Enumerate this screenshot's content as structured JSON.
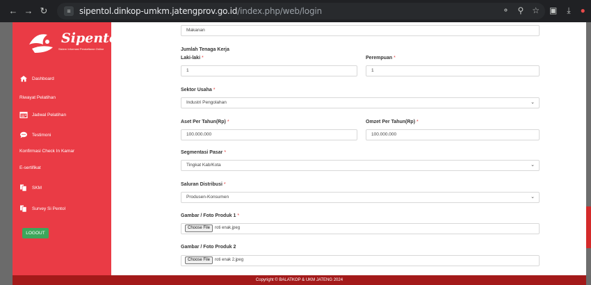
{
  "browser": {
    "url_host": "sipentol.dinkop-umkm.jatengprov.go.id",
    "url_path": "/index.php/web/login"
  },
  "sidebar": {
    "logo_text": "Sipentol",
    "logo_sub": "Sistem Informasi Pendaftaran Online",
    "items": [
      {
        "label": "Dashboard",
        "icon": "home-icon"
      },
      {
        "label": "Riwayat Pelatihan",
        "icon": ""
      },
      {
        "label": "Jadwal Pelatihan",
        "icon": "calendar-icon"
      },
      {
        "label": "Testimoni",
        "icon": "chat-icon"
      },
      {
        "label": "Konfirmasi Check In Kamar",
        "icon": ""
      },
      {
        "label": "E-sertifikat",
        "icon": ""
      },
      {
        "label": "SKM",
        "icon": "files-icon"
      },
      {
        "label": "Survey Si Pentol",
        "icon": "files-icon"
      }
    ],
    "logout_label": "LOGOUT"
  },
  "form": {
    "top_value": "Makanan",
    "tenaga_kerja_title": "Jumlah Tenaga Kerja",
    "laki_label": "Laki-laki",
    "laki_value": "1",
    "perempuan_label": "Perempuan",
    "perempuan_value": "1",
    "sektor_label": "Sektor Usaha",
    "sektor_value": "Industri Pengolahan",
    "aset_label": "Aset Per Tahun(Rp)",
    "aset_value": "100.000.000",
    "omzet_label": "Omzet Per Tahun(Rp)",
    "omzet_value": "100.000.000",
    "segmentasi_label": "Segmentasi Pasar",
    "segmentasi_value": "Tingkat Kab/Kota",
    "saluran_label": "Saluran Distribusi",
    "saluran_value": "Produsen-Konsumen",
    "foto1_label": "Gambar / Foto Produk 1",
    "foto1_file": "roti enak.jpeg",
    "foto2_label": "Gambar / Foto Produk 2",
    "foto2_file": "roti enak 2.jpeg",
    "choose_file_label": "Choose File",
    "required_mark": "*"
  },
  "footer": {
    "copyright": "Copyright © BALATKOP & UKM JATENG 2024"
  },
  "colors": {
    "sidebar": "#ea3b45",
    "footer": "#a31a1a",
    "logout": "#3da75b"
  }
}
